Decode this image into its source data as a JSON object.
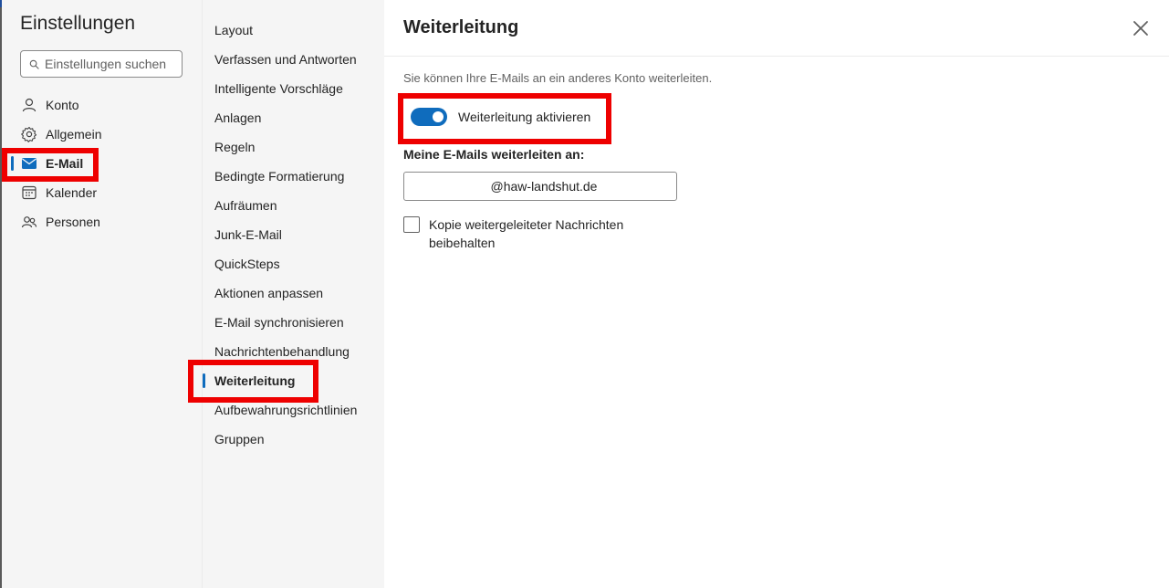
{
  "settings": {
    "title": "Einstellungen",
    "search_placeholder": "Einstellungen suchen"
  },
  "nav1": {
    "items": [
      {
        "label": "Konto",
        "icon": "person-icon"
      },
      {
        "label": "Allgemein",
        "icon": "gear-icon"
      },
      {
        "label": "E-Mail",
        "icon": "mail-icon",
        "selected": true
      },
      {
        "label": "Kalender",
        "icon": "calendar-icon"
      },
      {
        "label": "Personen",
        "icon": "people-icon"
      }
    ]
  },
  "nav2": {
    "items": [
      {
        "label": "Layout"
      },
      {
        "label": "Verfassen und Antworten"
      },
      {
        "label": "Intelligente Vorschläge"
      },
      {
        "label": "Anlagen"
      },
      {
        "label": "Regeln"
      },
      {
        "label": "Bedingte Formatierung"
      },
      {
        "label": "Aufräumen"
      },
      {
        "label": "Junk-E-Mail"
      },
      {
        "label": "QuickSteps"
      },
      {
        "label": "Aktionen anpassen"
      },
      {
        "label": "E-Mail synchronisieren"
      },
      {
        "label": "Nachrichtenbehandlung"
      },
      {
        "label": "Weiterleitung",
        "selected": true
      },
      {
        "label": "Aufbewahrungsrichtlinien"
      },
      {
        "label": "Gruppen"
      }
    ]
  },
  "main": {
    "title": "Weiterleitung",
    "description": "Sie können Ihre E-Mails an ein anderes Konto weiterleiten.",
    "toggle_label": "Weiterleitung aktivieren",
    "toggle_on": true,
    "forward_label": "Meine E-Mails weiterleiten an:",
    "forward_value": "@haw-landshut.de",
    "keep_copy_label": "Kopie weitergeleiteter Nachrichten beibehalten",
    "keep_copy_checked": false
  },
  "colors": {
    "accent": "#0f6cbd",
    "highlight": "#ee0000",
    "pane_bg": "#f5f5f5"
  }
}
